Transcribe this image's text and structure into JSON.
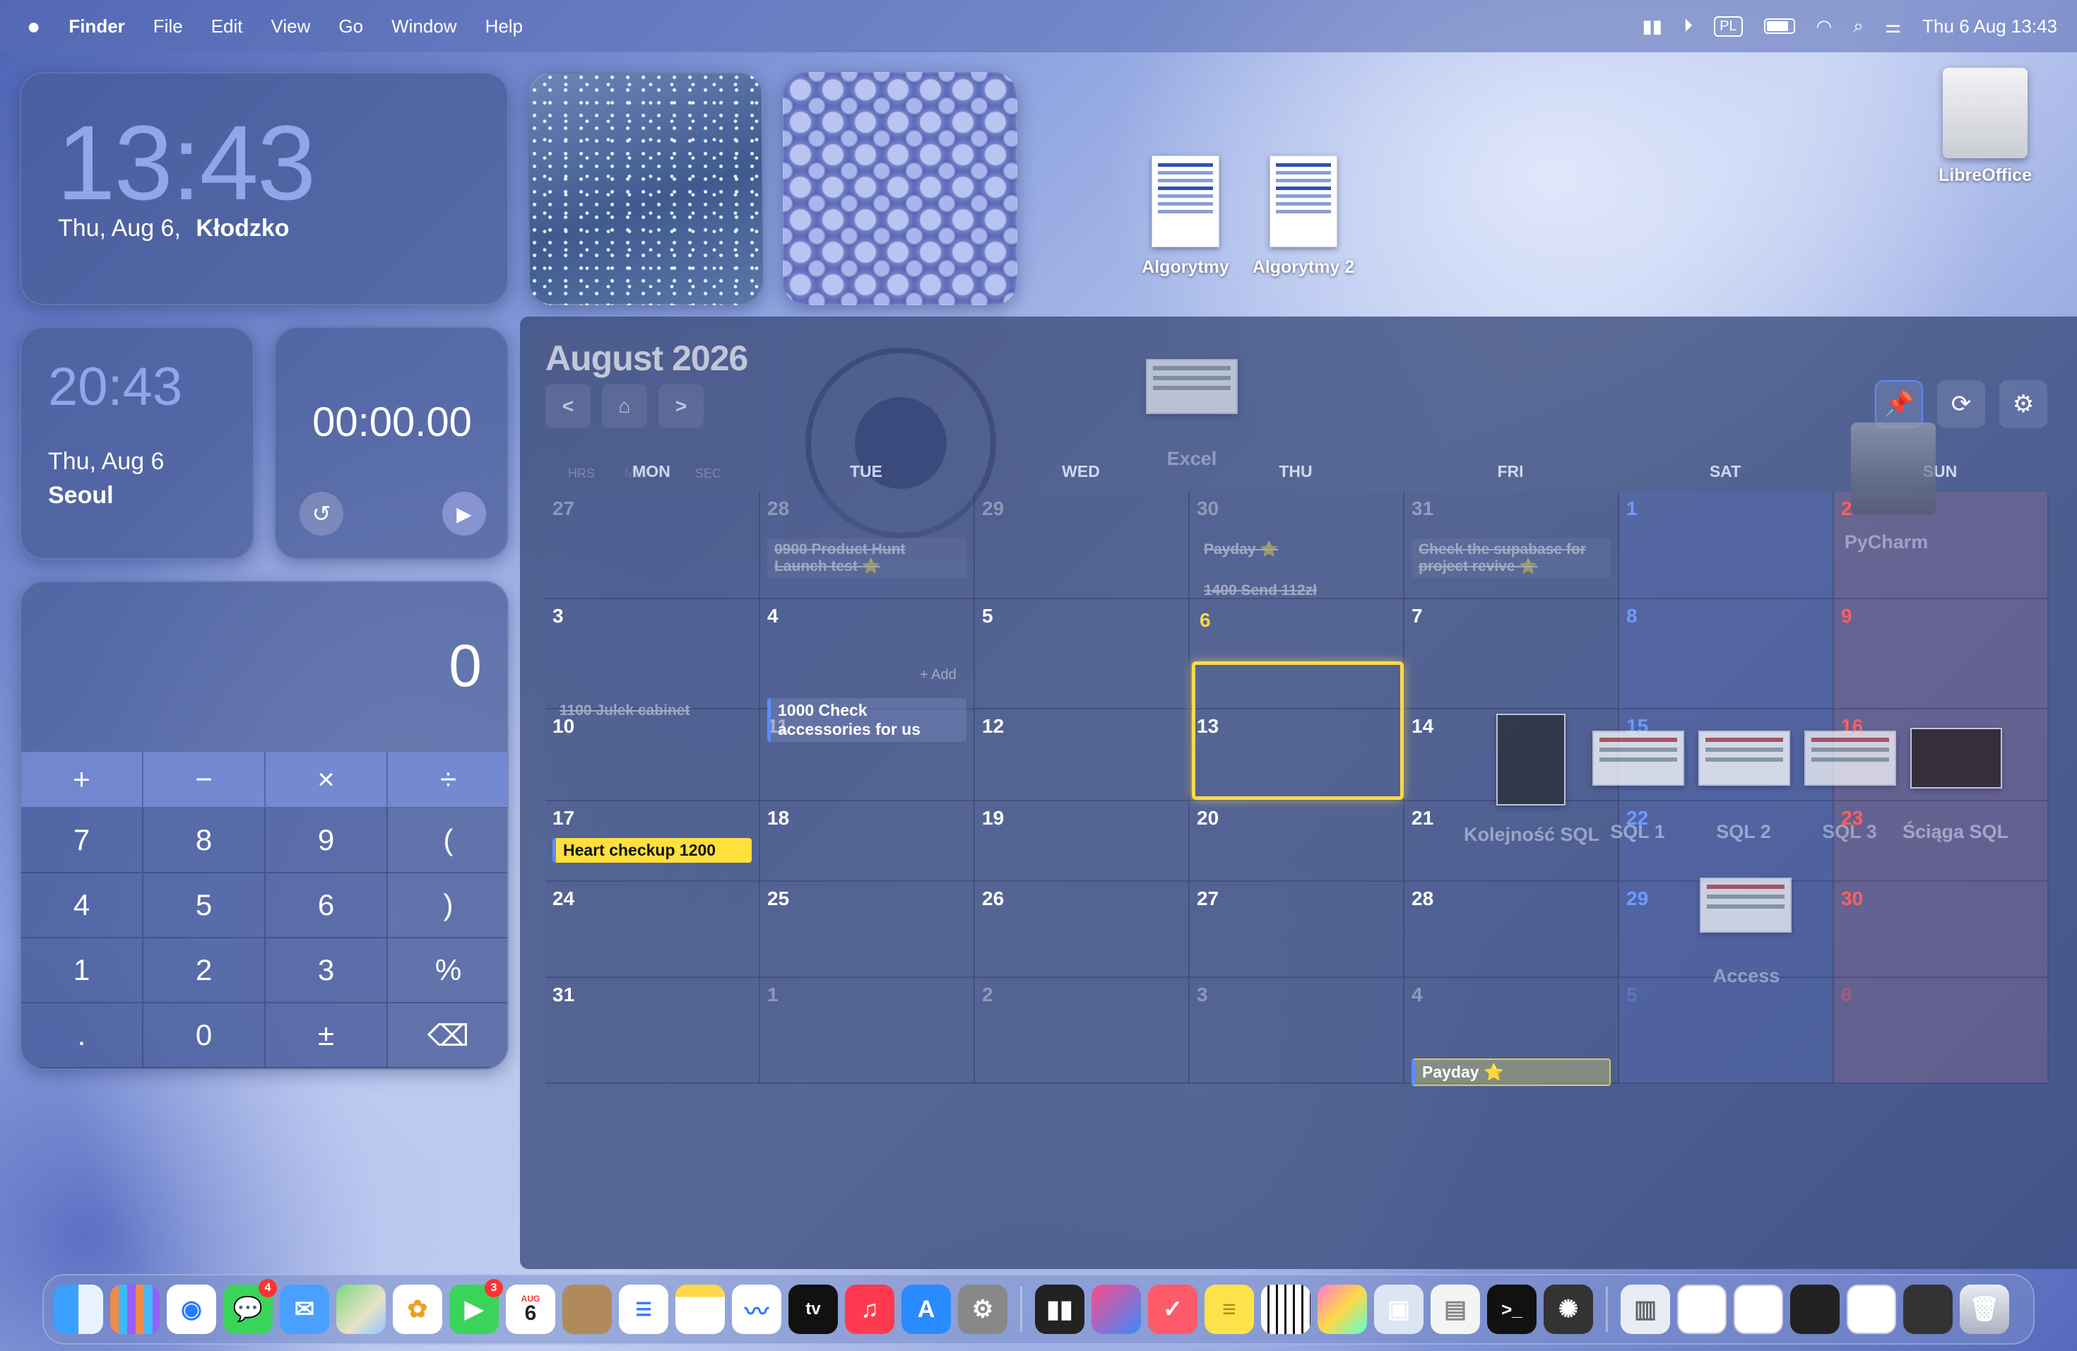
{
  "menubar": {
    "app": "Finder",
    "items": [
      "File",
      "Edit",
      "View",
      "Go",
      "Window",
      "Help"
    ],
    "input_source": "PL",
    "datetime": "Thu 6 Aug  13:43"
  },
  "clock_main": {
    "time": "13:43",
    "date": "Thu, Aug 6,",
    "city": "Kłodzko"
  },
  "clock_seoul": {
    "time": "20:43",
    "date": "Thu, Aug 6",
    "city": "Seoul"
  },
  "stopwatch": {
    "value": "00:00.00"
  },
  "calculator": {
    "display": "0",
    "ops": [
      "+",
      "−",
      "×",
      "÷"
    ],
    "rows": [
      [
        "7",
        "8",
        "9",
        "("
      ],
      [
        "4",
        "5",
        "6",
        ")"
      ],
      [
        "1",
        "2",
        "3",
        "%"
      ],
      [
        ".",
        "0",
        "±",
        "⌫"
      ]
    ]
  },
  "desktop_icons": {
    "doc1": "Algorytmy",
    "doc2": "Algorytmy 2",
    "drive": "LibreOffice",
    "excel": "Excel",
    "pycharm": "PyCharm",
    "sql_order": "Kolejność SQL",
    "sql1": "SQL 1",
    "sql2": "SQL 2",
    "sql3": "SQL 3",
    "sql_cheat": "Ściąga SQL",
    "access": "Access"
  },
  "calendar": {
    "title": "August 2026",
    "weekdays": [
      "MON",
      "TUE",
      "WED",
      "THU",
      "FRI",
      "SAT",
      "SUN"
    ],
    "timer_labels": [
      "HRS",
      "MIN",
      "SEC"
    ],
    "add_label": "+ Add",
    "weeks": [
      [
        "27",
        "28",
        "29",
        "30",
        "31",
        "1",
        "2"
      ],
      [
        "3",
        "4",
        "5",
        "6",
        "7",
        "8",
        "9"
      ],
      [
        "10",
        "11",
        "12",
        "13",
        "14",
        "15",
        "16"
      ],
      [
        "17",
        "18",
        "19",
        "20",
        "21",
        "22",
        "23"
      ],
      [
        "24",
        "25",
        "26",
        "27",
        "28",
        "29",
        "30"
      ],
      [
        "31",
        "1",
        "2",
        "3",
        "4",
        "5",
        "6"
      ]
    ],
    "events": {
      "e1": "0900 Product Hunt Launch test ⭐",
      "e2": "Payday ⭐",
      "e3": "1400 Send 112zł",
      "e4": "Check the supabase for project revive ⭐",
      "e5": "1100 Julek cabinet",
      "e6": "1000 Check accessories for us",
      "e7": "Heart checkup 1200",
      "e8": "Payday ⭐"
    },
    "accent": "#ffd84a"
  },
  "dock": {
    "calendar_month": "AUG",
    "calendar_day": "6",
    "badges": {
      "messages": "4",
      "facetime": "3"
    }
  }
}
